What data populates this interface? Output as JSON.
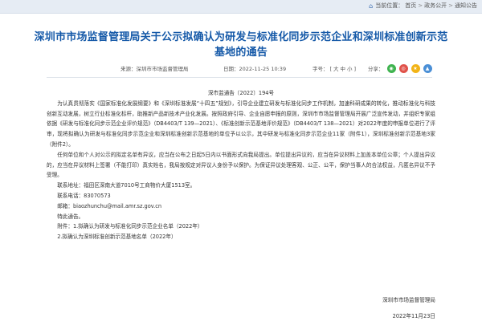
{
  "breadcrumb": {
    "prefix": "当前位置：",
    "home": "首页",
    "section": "政务公开",
    "current": "通知公告",
    "sep": ">"
  },
  "article": {
    "title": "深圳市市场监督管理局关于公示拟确认为研发与标准化同步示范企业和深圳标准创新示范基地的通告",
    "source": "来源：深圳市市场监督管理局",
    "date": "日期：2022-11-25 10:39",
    "font_size_label": "字号：",
    "font_sizes": [
      "[",
      "大",
      "中",
      "小",
      "]"
    ],
    "share_label": "分享：",
    "doc_number": "深市监通告〔2022〕194号",
    "paragraphs": [
      "为认真贯彻落实《国家标准化发展纲要》和《深圳标准发展“十四五”规划》，引导企业建立研发与标准化同步工作机制，加速科研成果的转化，推动标准化与科技创新互动发展，树立行业标准化标杆，助推新产品新技术产业化发展。按照政府引导、企业自愿申报的原则，深圳市市场监督管理局开展广泛宣传发动，并组织专家组依据《研发与标准化同步示范企业评价规范》（DB4403/T 139—2021）、《标准创新示范基地评价规范》（DB4403/T 138—2021）对2022年度的申报单位进行了评审，现将拟确认为研发与标准化同步示范企业和深圳标准创新示范基地的单位予以公示，其中研发与标准化同步示范企业11家（附件1），深圳标准创新示范基地3家（附件2）。",
      "任何单位和个人对公示的拟定名单有异议，应当在公布之日起5日内以书面形式向我局提出。单位提出异议的，应当在异议材料上加盖本单位公章；个人提出异议的，应当在异议材料上签署（不能打印）真实姓名，我局按规定对异议人身份予以保护。为保证异议处理客观、公正、公平，保护当事人的合法权益，凡匿名异议不予受理。",
      "联系地址：福田区深南大道7010号工商物价大厦1513室。",
      "联系电话：83070573",
      "邮箱：biaozhunchu@mail.amr.sz.gov.cn",
      "特此通告。",
      "附件：1.拟确认为研发与标准化同步示范企业名单（2022年）",
      "2.拟确认为深圳标准创新示范基地名单（2022年）"
    ],
    "signature": "深圳市市场监督管理局",
    "signature_date": "2022年11月23日"
  },
  "colors": {
    "title": "#1559a8",
    "topbar": "#e6ecf4",
    "share_wechat": "#3fb34f",
    "share_weibo": "#e0524a",
    "share_qzone": "#f2b418",
    "share_other": "#4a8fd6"
  },
  "icons": {
    "home": "home-icon",
    "share": [
      "wechat-icon",
      "weibo-icon",
      "qzone-icon",
      "share-more-icon"
    ]
  }
}
